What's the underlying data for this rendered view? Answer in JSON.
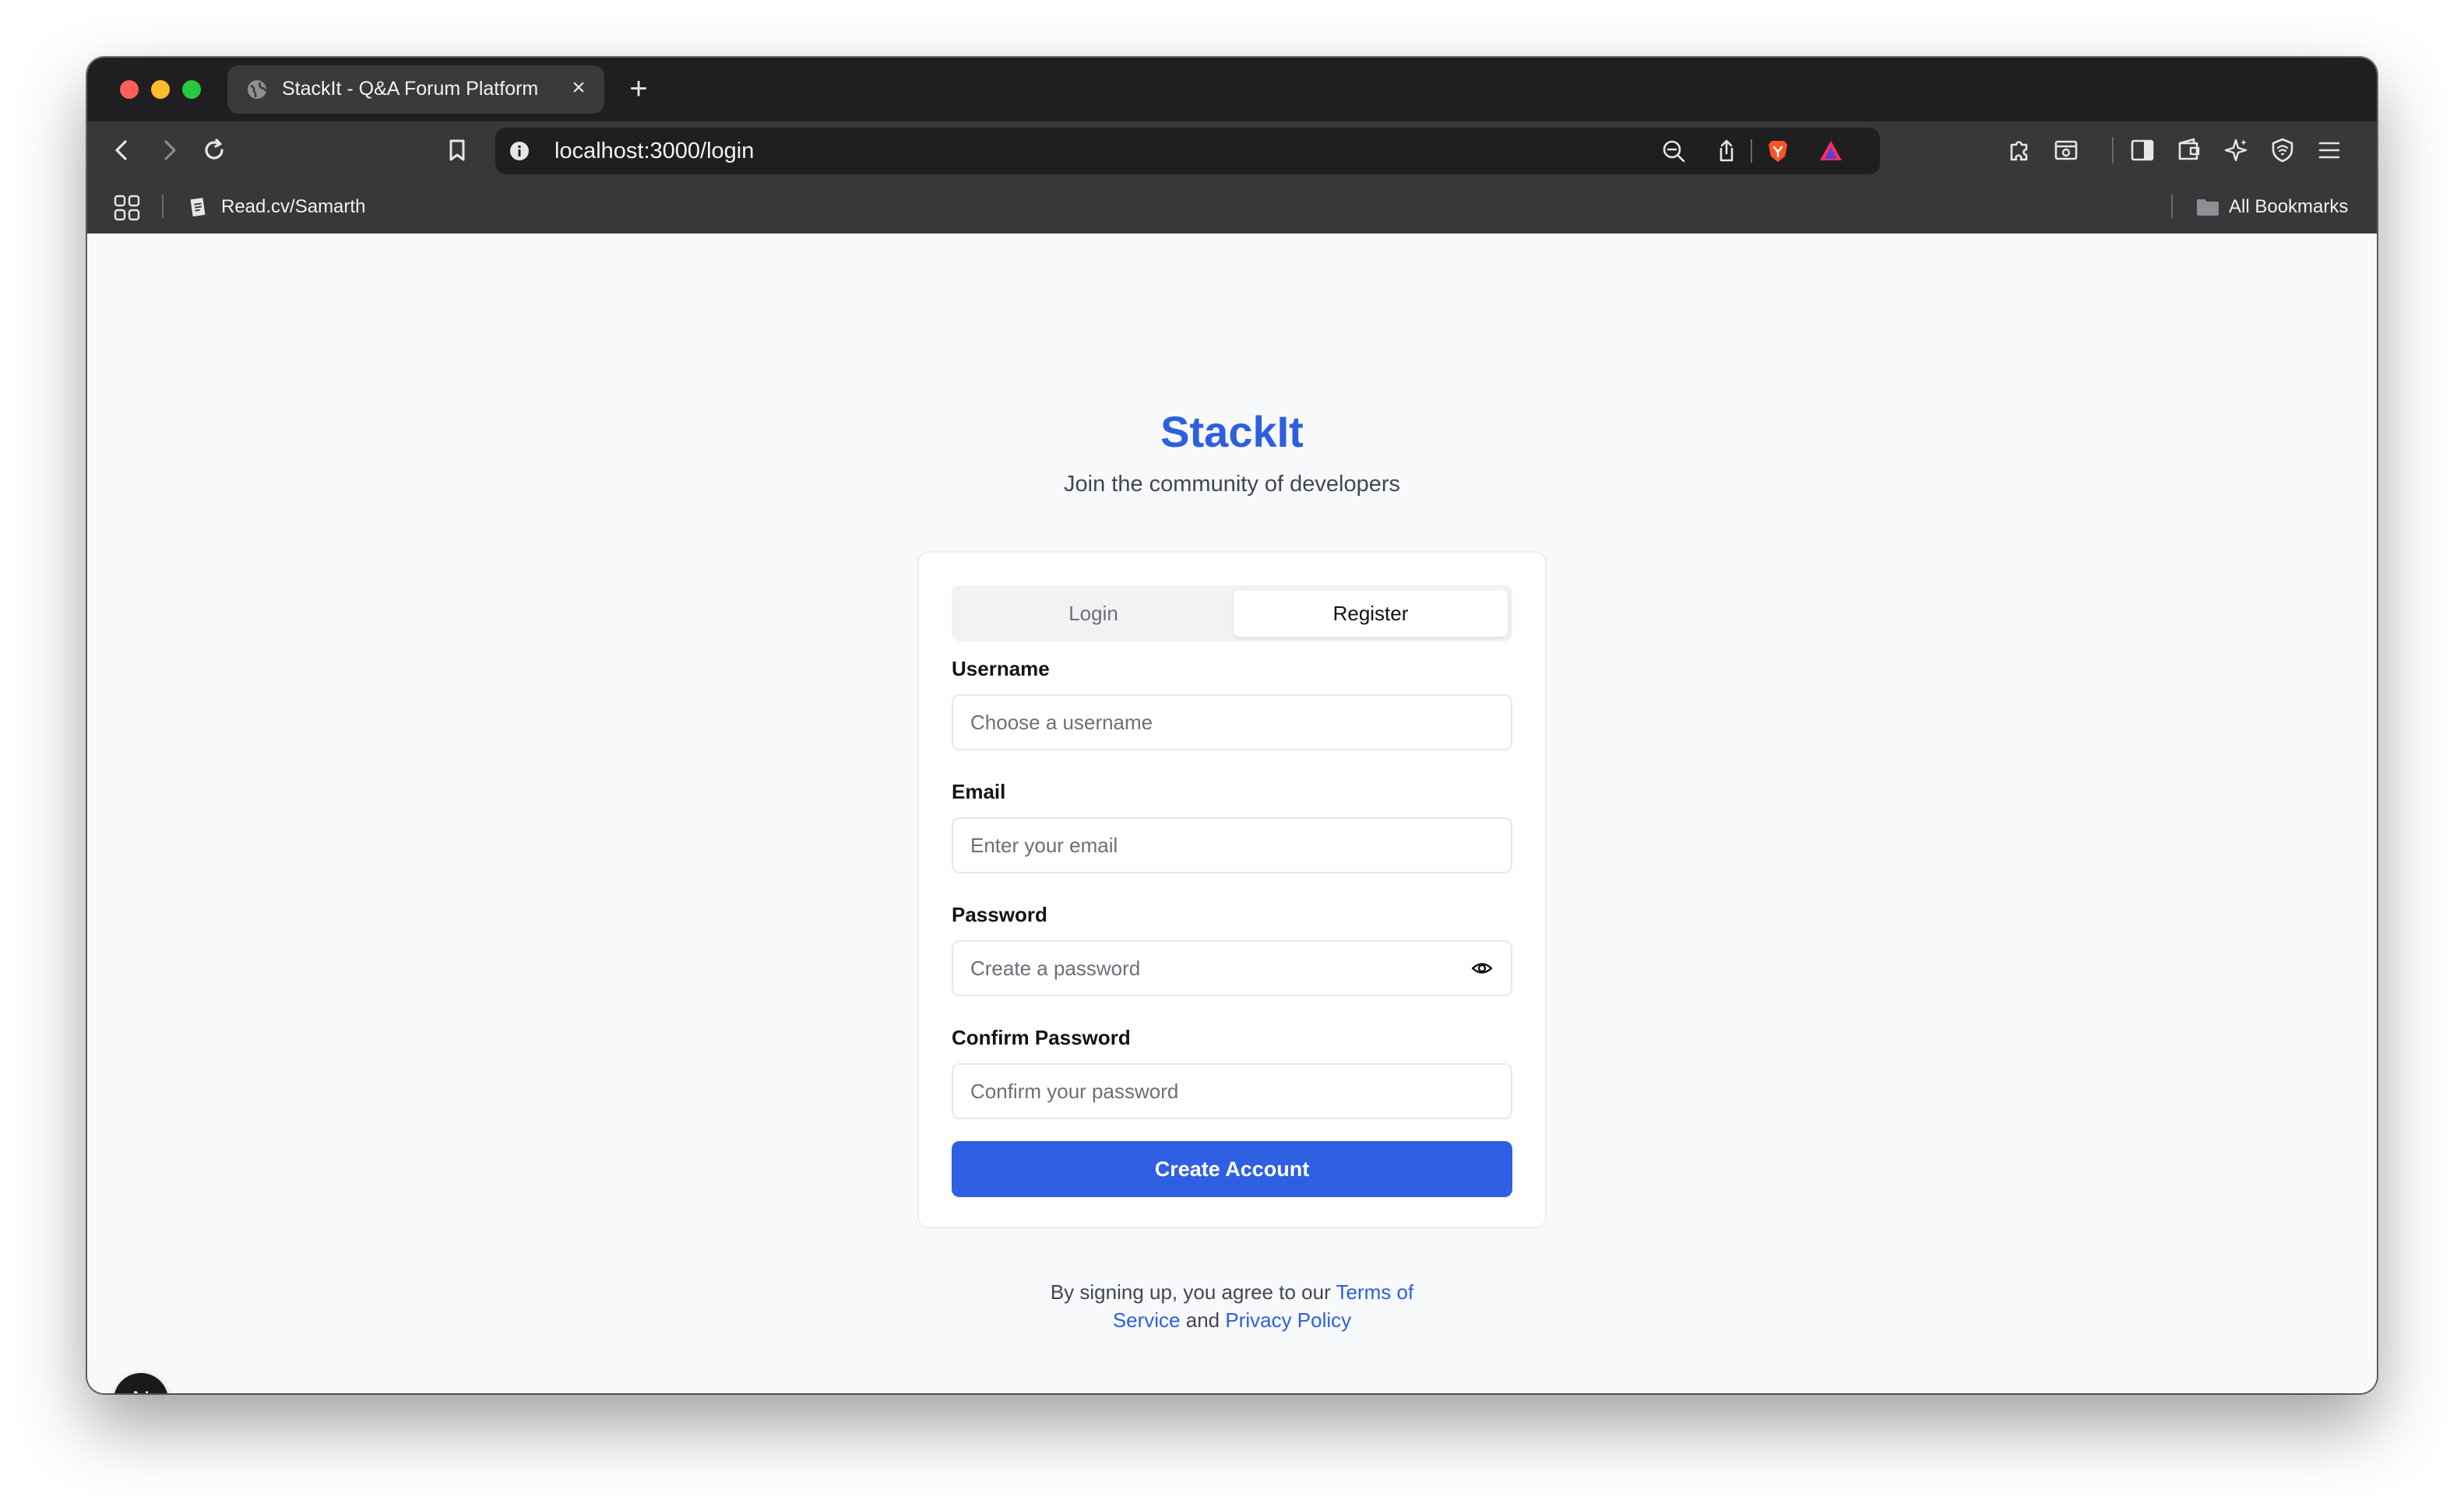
{
  "browser": {
    "tab_title": "StackIt - Q&A Forum Platform",
    "tab_close": "×",
    "new_tab": "+",
    "url": "localhost:3000/login",
    "bookmark_item": "Read.cv/Samarth",
    "bookmark_folder": "All Bookmarks",
    "icons": [
      "back-icon",
      "forward-icon",
      "reload-icon",
      "bookmark-icon",
      "info-icon",
      "zoom-out-icon",
      "share-icon",
      "brave-shield-icon",
      "brave-rewards-icon",
      "extensions-icon",
      "screenshot-icon",
      "sidebar-icon",
      "wallet-icon",
      "leo-ai-icon",
      "vpn-icon",
      "menu-icon"
    ]
  },
  "page": {
    "brand": "StackIt",
    "subtitle": "Join the community of developers",
    "tabs": {
      "login": "Login",
      "register": "Register",
      "active": "Register"
    },
    "form": {
      "username_label": "Username",
      "username_placeholder": "Choose a username",
      "email_label": "Email",
      "email_placeholder": "Enter your email",
      "password_label": "Password",
      "password_placeholder": "Create a password",
      "confirm_label": "Confirm Password",
      "confirm_placeholder": "Confirm your password",
      "submit": "Create Account"
    },
    "terms": {
      "prefix": "By signing up, you agree to our ",
      "tos": "Terms of Service",
      "and": " and ",
      "privacy": "Privacy Policy"
    },
    "badge": "N"
  },
  "colors": {
    "brand": "#2d5fde",
    "button": "#2f5fe3",
    "page_bg": "#f8f9fb"
  }
}
